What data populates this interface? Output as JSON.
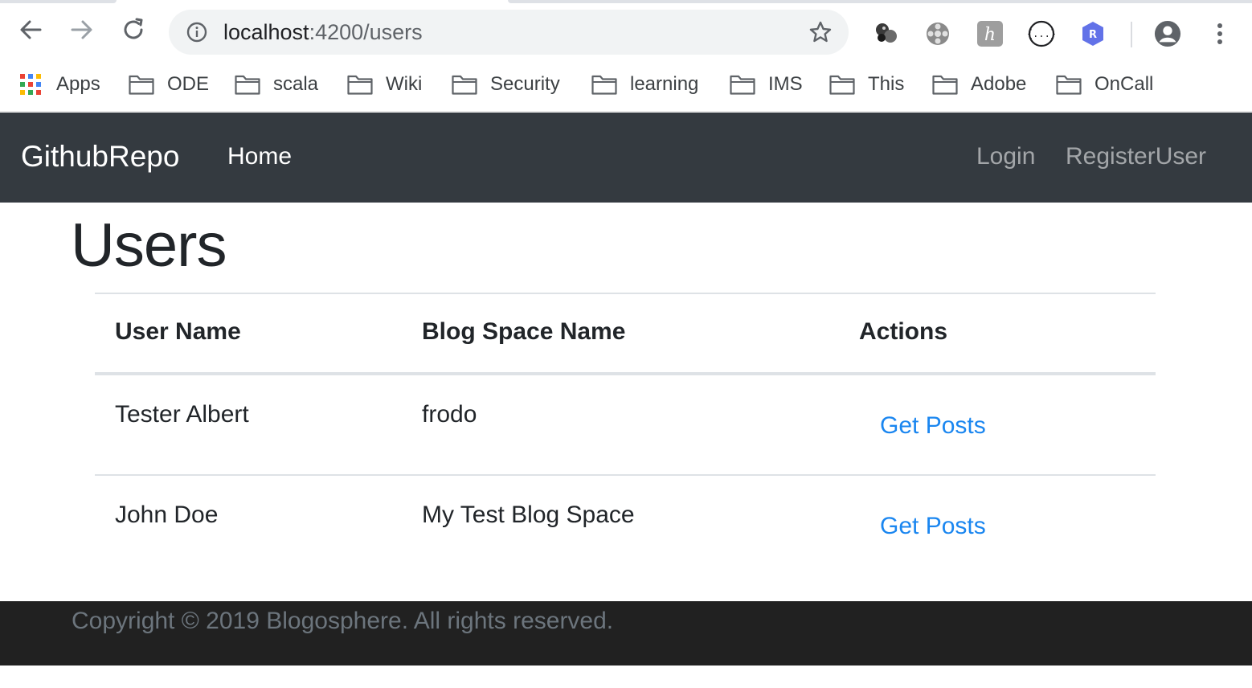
{
  "browser": {
    "url_host": "localhost",
    "url_path": ":4200/users",
    "nav_icons": [
      "back-arrow-icon",
      "forward-arrow-icon",
      "reload-icon"
    ],
    "extension_icons": [
      "balls-extension-icon",
      "film-reel-extension-icon",
      "h-extension-icon",
      "json-braces-extension-icon",
      "r-shield-extension-icon"
    ],
    "bookmarks": [
      {
        "label": "Apps",
        "icon": "apps-grid-icon"
      },
      {
        "label": "ODE",
        "icon": "folder-icon"
      },
      {
        "label": "scala",
        "icon": "folder-icon"
      },
      {
        "label": "Wiki",
        "icon": "folder-icon"
      },
      {
        "label": "Security",
        "icon": "folder-icon"
      },
      {
        "label": "learning",
        "icon": "folder-icon"
      },
      {
        "label": "IMS",
        "icon": "folder-icon"
      },
      {
        "label": "This",
        "icon": "folder-icon"
      },
      {
        "label": "Adobe",
        "icon": "folder-icon"
      },
      {
        "label": "OnCall",
        "icon": "folder-icon"
      }
    ]
  },
  "navbar": {
    "brand": "GithubRepo",
    "home": "Home",
    "login": "Login",
    "register": "RegisterUser"
  },
  "page": {
    "title": "Users"
  },
  "table": {
    "headers": [
      "User Name",
      "Blog Space Name",
      "Actions"
    ],
    "rows": [
      {
        "user_name": "Tester Albert",
        "blog_space": "frodo",
        "action": "Get Posts"
      },
      {
        "user_name": "John Doe",
        "blog_space": "My Test Blog Space",
        "action": "Get Posts"
      }
    ]
  },
  "footer": {
    "copyright": "Copyright © 2019 Blogosphere. All rights reserved."
  },
  "colors": {
    "navbar_bg": "#343a40",
    "link": "#1a86f0",
    "footer_bg": "#212121"
  }
}
